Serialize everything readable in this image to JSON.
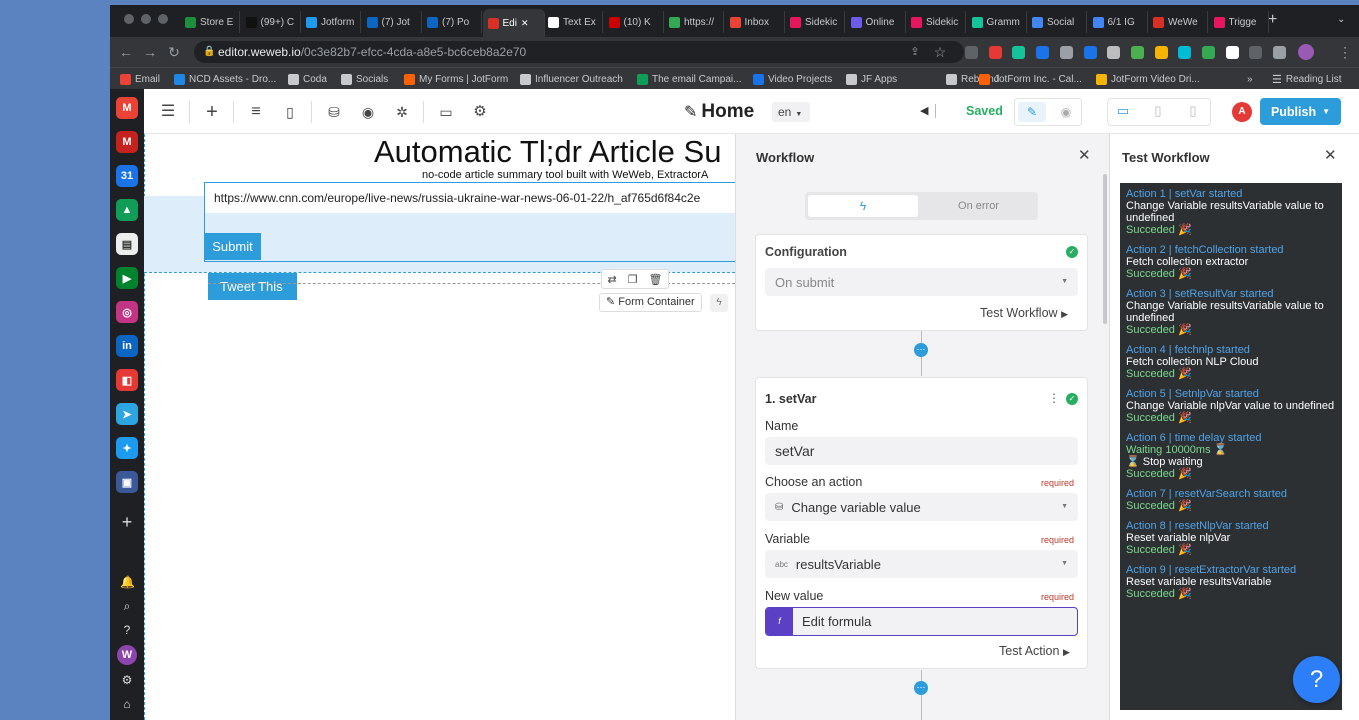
{
  "browser": {
    "tabs": [
      {
        "label": "Store E",
        "color": "#1e8e3e"
      },
      {
        "label": "(99+) C",
        "color": "#111111"
      },
      {
        "label": "Jotform",
        "color": "#1d9bf0"
      },
      {
        "label": "(7) Jot",
        "color": "#0a66c2"
      },
      {
        "label": "(7) Po",
        "color": "#0a66c2"
      },
      {
        "label": "Edi",
        "color": "#d93025"
      },
      {
        "label": "Text Ex",
        "color": "#ffffff"
      },
      {
        "label": "(10) K",
        "color": "#cc0000"
      },
      {
        "label": "https://",
        "color": "#34a853"
      },
      {
        "label": "Inbox",
        "color": "#ea4335"
      },
      {
        "label": "Sidekic",
        "color": "#e8175d"
      },
      {
        "label": "Online",
        "color": "#6c5ce7"
      },
      {
        "label": "Sidekic",
        "color": "#e8175d"
      },
      {
        "label": "Gramm",
        "color": "#15c39a"
      },
      {
        "label": "Social",
        "color": "#4285f4"
      },
      {
        "label": "6/1 IG",
        "color": "#4285f4"
      },
      {
        "label": "WeWe",
        "color": "#d93025"
      },
      {
        "label": "Trigge",
        "color": "#e8175d"
      }
    ],
    "new_tab": "+",
    "url_host": "editor.weweb.io",
    "url_path": "/0c3e82b7-efcc-4cda-a8e5-bc6ceb8a2e70",
    "bookmarks": [
      "Email",
      "NCD Assets - Dro...",
      "Coda",
      "Socials",
      "My Forms | JotForm",
      "Influencer Outreach",
      "The email Campai...",
      "Video Projects",
      "JF Apps",
      "Rebrand",
      "JotForm Inc. - Cal...",
      "JotForm Video Dri..."
    ],
    "bookmarks_more": "»",
    "reading_list": "Reading List"
  },
  "editor": {
    "page_name": "Home",
    "language": "en",
    "status": "Saved",
    "avatar": "A",
    "publish_label": "Publish",
    "rail_avatar": "W"
  },
  "canvas": {
    "title": "Automatic Tl;dr Article Su",
    "subtitle": "no-code article summary tool built with WeWeb, ExtractorA",
    "url_value": "https://www.cnn.com/europe/live-news/russia-ukraine-war-news-06-01-22/h_af765d6f84c2e",
    "submit_label": "Submit",
    "tweet_label": "Tweet This",
    "container_label": "Form Container"
  },
  "workflow": {
    "title": "Workflow",
    "tab_error": "On error",
    "config_title": "Configuration",
    "trigger_value": "On submit",
    "test_workflow_label": "Test Workflow",
    "action_title": "1. setVar",
    "name_label": "Name",
    "name_value": "setVar",
    "choose_label": "Choose an action",
    "required": "required",
    "action_value": "Change variable value",
    "variable_label": "Variable",
    "variable_value": "resultsVariable",
    "variable_type": "abc",
    "new_value_label": "New value",
    "formula_icon": "f",
    "formula_label": "Edit formula",
    "test_action_label": "Test Action"
  },
  "test_panel": {
    "title": "Test Workflow",
    "help": "?",
    "log": [
      {
        "head": "Action 1 | setVar started",
        "body": "Change Variable resultsVariable value to undefined",
        "status": "Succeded 🎉"
      },
      {
        "head": "Action 2 | fetchCollection started",
        "body": "Fetch collection extractor",
        "status": "Succeded 🎉"
      },
      {
        "head": "Action 3 | setResultVar started",
        "body": "Change Variable resultsVariable value to undefined",
        "status": "Succeded 🎉"
      },
      {
        "head": "Action 4 | fetchnlp started",
        "body": "Fetch collection NLP Cloud",
        "status": "Succeded 🎉"
      },
      {
        "head": "Action 5 | SetnlpVar started",
        "body": "Change Variable nlpVar value to undefined",
        "status": "Succeded 🎉"
      },
      {
        "head": "Action 6 | time delay started",
        "wait": "Waiting 10000ms ⌛",
        "body": "⌛ Stop waiting",
        "status": "Succeded 🎉"
      },
      {
        "head": "Action 7 | resetVarSearch started",
        "status": "Succeded 🎉"
      },
      {
        "head": "Action 8 | resetNlpVar started",
        "body": "Reset variable nlpVar",
        "status": "Succeded 🎉"
      },
      {
        "head": "Action 9 | resetExtractorVar started",
        "body": "Reset variable resultsVariable",
        "status": "Succeded 🎉"
      }
    ]
  },
  "colors": {
    "accent": "#2d9cdb",
    "success": "#27ae60",
    "formula": "#5b3fc4",
    "required": "#c0392b"
  }
}
